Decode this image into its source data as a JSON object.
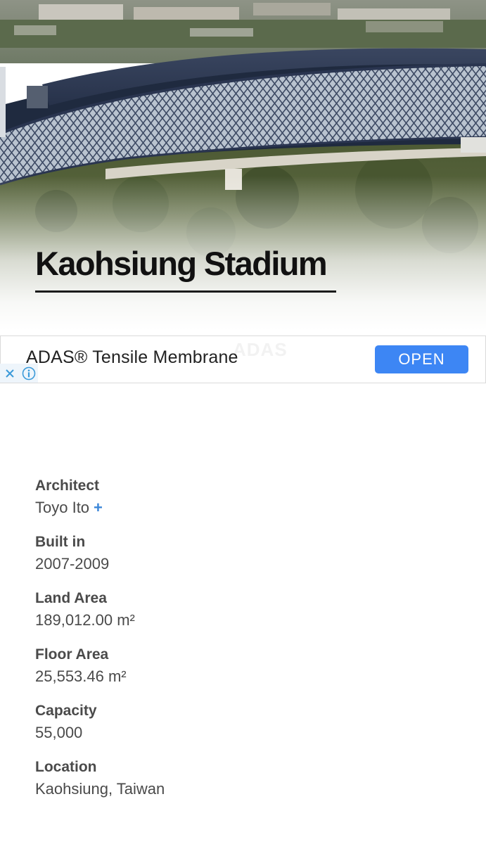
{
  "hero": {
    "image_description_icon": "stadium-photo",
    "title": "Kaohsiung Stadium"
  },
  "ad": {
    "text": "ADAS® Tensile Membrane",
    "button_label": "OPEN",
    "close_icon": "close-icon",
    "info_icon": "info-icon",
    "accent_color": "#3d86f4"
  },
  "details": {
    "architect": {
      "label": "Architect",
      "value": "Toyo Ito",
      "more": "+"
    },
    "built": {
      "label": "Built in",
      "value": "2007-2009"
    },
    "land_area": {
      "label": "Land Area",
      "value": "189,012.00 m²"
    },
    "floor_area": {
      "label": "Floor Area",
      "value": "25,553.46 m²"
    },
    "capacity": {
      "label": "Capacity",
      "value": "55,000"
    },
    "location": {
      "label": "Location",
      "value": "Kaohsiung, Taiwan"
    }
  }
}
